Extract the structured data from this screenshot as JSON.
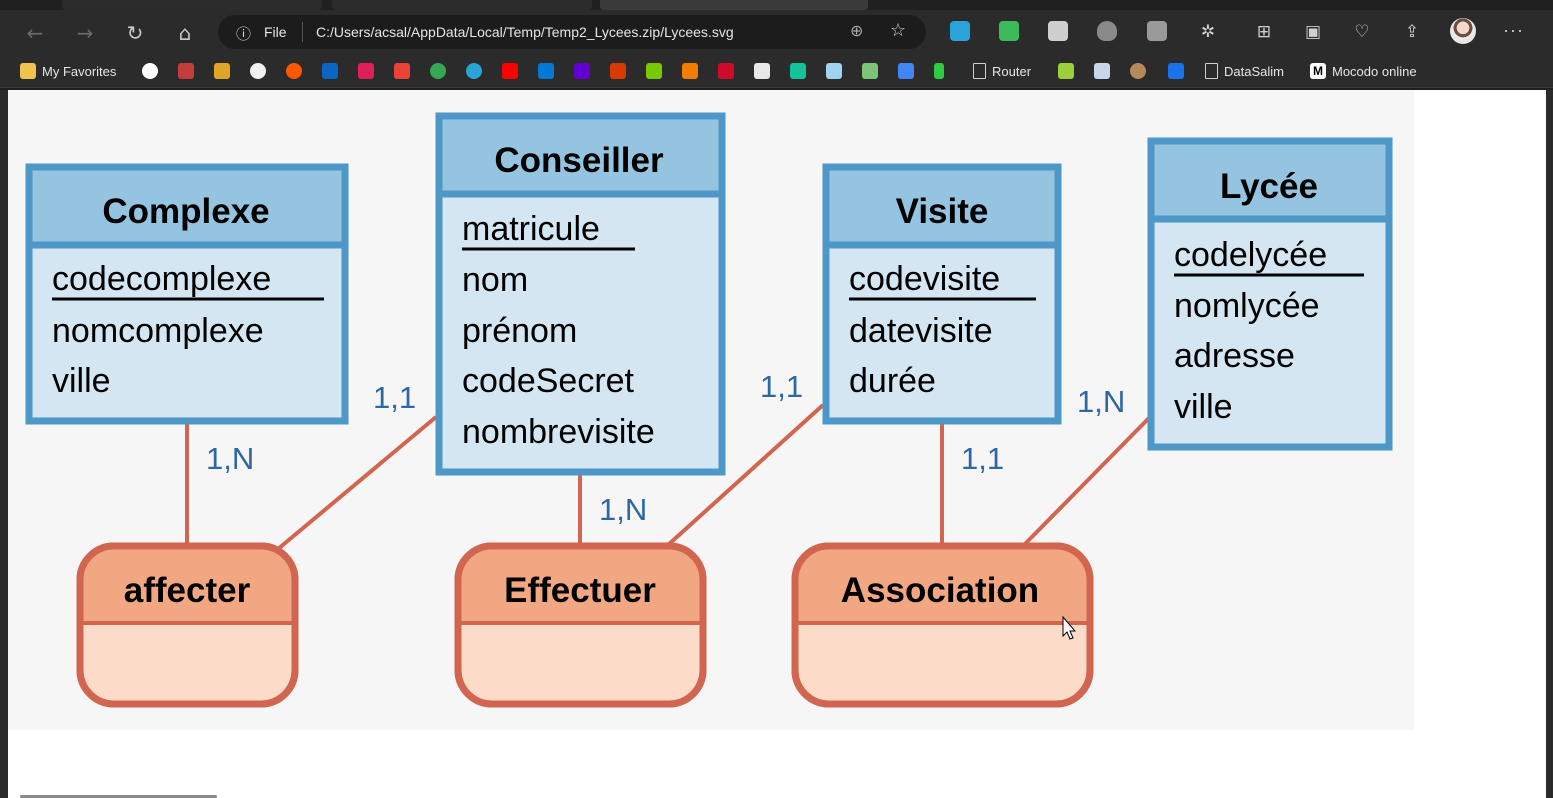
{
  "browser": {
    "address": {
      "scheme": "File",
      "url": "C:/Users/acsal/AppData/Local/Temp/Temp2_Lycees.zip/Lycees.svg"
    },
    "favorites": [
      {
        "label": "My Favorites",
        "icon": "folder-icon",
        "color": "#f2c14e"
      },
      {
        "label": "Router",
        "icon": "page-icon",
        "color": "#cfcfcf"
      },
      {
        "label": "DataSalim",
        "icon": "page-icon",
        "color": "#cfcfcf"
      },
      {
        "label": "Mocodo online",
        "icon": "mocodo-icon",
        "color": "#ffffff"
      }
    ]
  },
  "diagram": {
    "entities": [
      {
        "name": "Complexe",
        "id": "codecomplexe",
        "attributes": [
          "nomcomplexe",
          "ville"
        ]
      },
      {
        "name": "Conseiller",
        "id": "matricule",
        "attributes": [
          "nom",
          "prénom",
          "codeSecret",
          "nombrevisite"
        ]
      },
      {
        "name": "Visite",
        "id": "codevisite",
        "attributes": [
          "datevisite",
          "durée"
        ]
      },
      {
        "name": "Lycée",
        "id": "codelycée",
        "attributes": [
          "nomlycée",
          "adresse",
          "ville"
        ]
      }
    ],
    "associations": [
      "affecter",
      "Effectuer",
      "Association"
    ],
    "cardinalities": [
      "1,N",
      "1,1",
      "1,N",
      "1,1",
      "1,1",
      "1,N"
    ],
    "colors": {
      "entity_border": "#4e97c9",
      "entity_header": "#94c4e0",
      "entity_body": "#d3e6f2",
      "association_border": "#d2654f",
      "association_header": "#f2a783",
      "association_body": "#fcdcc8",
      "link": "#d2654f",
      "cardinality": "#2f66a4"
    }
  }
}
